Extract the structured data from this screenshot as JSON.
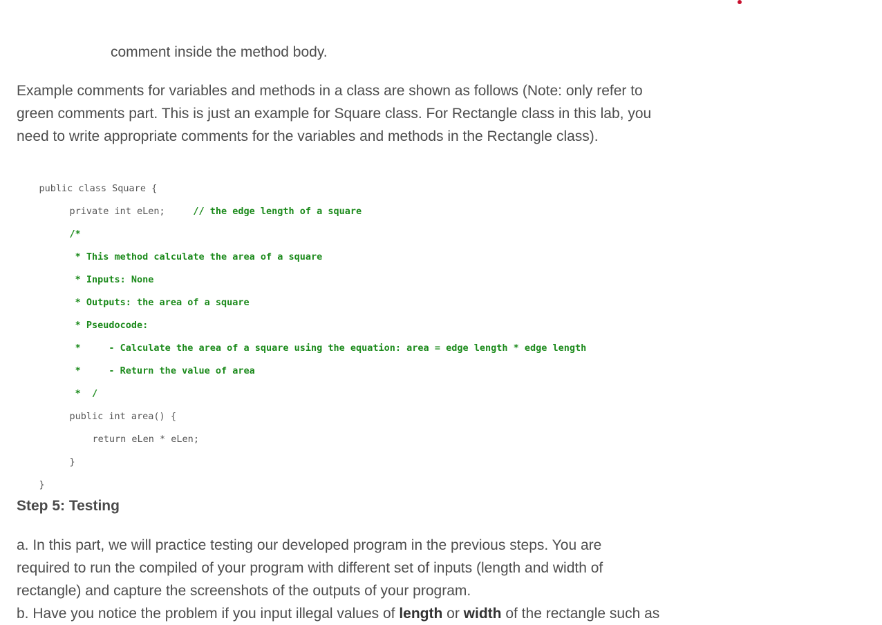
{
  "decor": {
    "accent_dot_color": "#c8102e"
  },
  "intro": {
    "continuation": "comment inside the method body."
  },
  "example_paragraph": {
    "line1": "Example comments for variables and methods in a class are shown as follows (Note: only refer to",
    "line2": "green comments part. This is just an example for Square class. For Rectangle class in this lab, you",
    "line3": "need to write appropriate comments for the variables and methods in the Rectangle class)."
  },
  "code_example": {
    "comment_color": "#1b8a1b",
    "lines": [
      {
        "code": "public class Square {",
        "comment": ""
      },
      {
        "code": "private int eLen;     ",
        "comment": "// the edge length of a square"
      },
      {
        "code": "",
        "comment": "/*"
      },
      {
        "code": "",
        "comment": " * This method calculate the area of a square"
      },
      {
        "code": "",
        "comment": " * Inputs: None"
      },
      {
        "code": "",
        "comment": " * Outputs: the area of a square"
      },
      {
        "code": "",
        "comment": " * Pseudocode:"
      },
      {
        "code": "",
        "comment": " *     - Calculate the area of a square using the equation: area = edge length * edge length"
      },
      {
        "code": "",
        "comment": " *     - Return the value of area"
      },
      {
        "code": "",
        "comment": " *  /"
      },
      {
        "code": "public int area() {",
        "comment": ""
      },
      {
        "code": "return eLen * eLen;",
        "comment": ""
      },
      {
        "code": "}",
        "comment": ""
      },
      {
        "code": "}",
        "comment": ""
      }
    ]
  },
  "step5": {
    "heading": "Step 5: Testing",
    "para_a_line1": "a. In this part, we will practice testing our developed program in the previous steps. You are",
    "para_a_line2": "required to run the compiled of your program with different set of inputs (length and width of",
    "para_a_line3": "rectangle) and capture the screenshots of the outputs of your program.",
    "para_b_prefix": "b. Have you notice the problem if you input illegal values of ",
    "para_b_bold1": "length",
    "para_b_mid": " or ",
    "para_b_bold2": "width",
    "para_b_suffix": " of the rectangle such as"
  }
}
